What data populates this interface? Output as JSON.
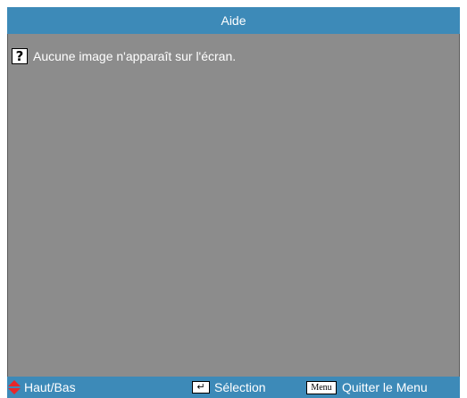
{
  "header": {
    "title": "Aide"
  },
  "help": {
    "icon": "question-mark-icon",
    "items": [
      {
        "text": "Aucune image n'apparaît sur l'écran."
      }
    ]
  },
  "footer": {
    "updown_icon": "up-down-arrows-icon",
    "updown_label": "Haut/Bas",
    "select_icon": "enter-key-icon",
    "select_label": "Sélection",
    "menu_key": "Menu",
    "menu_label": "Quitter le Menu"
  },
  "colors": {
    "title_bar": "#3d8ab8",
    "panel": "#8c8c8c",
    "arrow": "#e8262a",
    "text": "#ffffff"
  }
}
